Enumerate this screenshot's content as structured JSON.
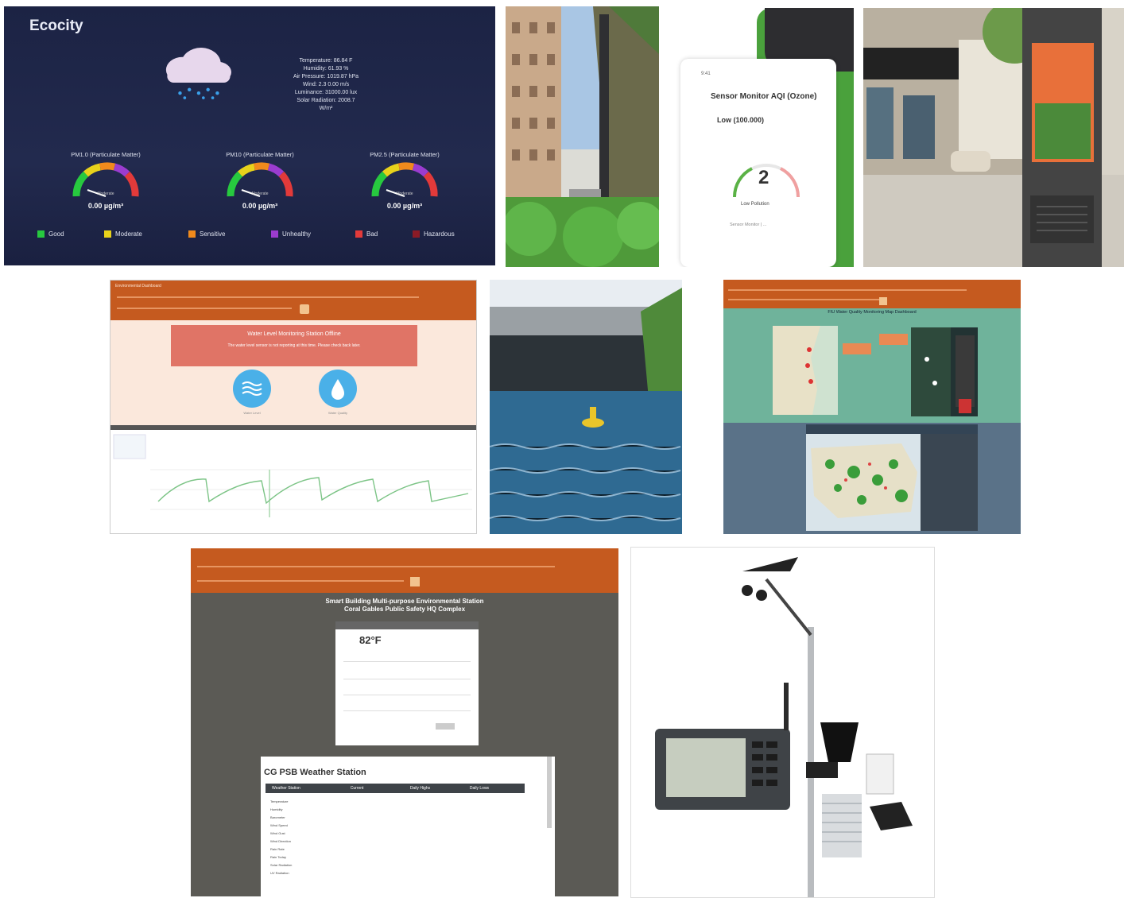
{
  "ecocity": {
    "title": "Ecocity",
    "readings": [
      "Temperature: 86.84 F",
      "Humidity: 61.93 %",
      "Air Pressure: 1019.87 hPa",
      "Wind: 2.3 0.00 m/s",
      "Luminance: 31000.00 lux",
      "Solar Radiation: 2008.7",
      "W/m²"
    ],
    "gauges": [
      {
        "label": "PM1.0 (Particulate Matter)",
        "value": "0.00 µg/m³",
        "caption": "Moderate"
      },
      {
        "label": "PM10 (Particulate Matter)",
        "value": "0.00 µg/m³",
        "caption": "Moderate"
      },
      {
        "label": "PM2.5 (Particulate Matter)",
        "value": "0.00 µg/m³",
        "caption": "Moderate"
      }
    ],
    "legend": [
      {
        "label": "Good",
        "color": "#27c93f"
      },
      {
        "label": "Moderate",
        "color": "#e8d21b"
      },
      {
        "label": "Sensitive",
        "color": "#f08a1c"
      },
      {
        "label": "Unhealthy",
        "color": "#9b3ccf"
      },
      {
        "label": "Bad",
        "color": "#e23a3a"
      },
      {
        "label": "Hazardous",
        "color": "#8a1b26"
      }
    ]
  },
  "phone": {
    "header": "9:41",
    "title": "Sensor Monitor AQI (Ozone)",
    "subtitle": "Low (100.000)",
    "aqi": "2",
    "aqi_caption": "Low Pollution",
    "footer": "Sensor Monitor | ..."
  },
  "dashboard1": {
    "topbar": "Environmental Dashboard",
    "alert_title": "Water Level Monitoring Station Offline",
    "alert_text": "The water level sensor is not reporting at this time. Please check back later.",
    "icons": [
      {
        "label": "Water Level",
        "icon": "waves-icon"
      },
      {
        "label": "Water Quality",
        "icon": "drop-icon"
      }
    ]
  },
  "dashboard2": {
    "title": "FIU Water Quality Monitoring Map Dashboard"
  },
  "dashboard3": {
    "heading1": "Smart Building Multi-purpose Environmental Station",
    "heading2": "Coral Gables Public Safety HQ Complex",
    "temp": "82°F",
    "weather_title": "CG PSB Weather Station",
    "table_headers": [
      "Weather Station",
      "Current",
      "Daily Highs",
      "Daily Lows"
    ],
    "rows": [
      "Temperature",
      "Humidity",
      "Barometer",
      "Wind Speed",
      "Wind Gust",
      "Wind Direction",
      "Rain Rate",
      "Rain Today",
      "Solar Radiation",
      "UV Radiation"
    ]
  }
}
